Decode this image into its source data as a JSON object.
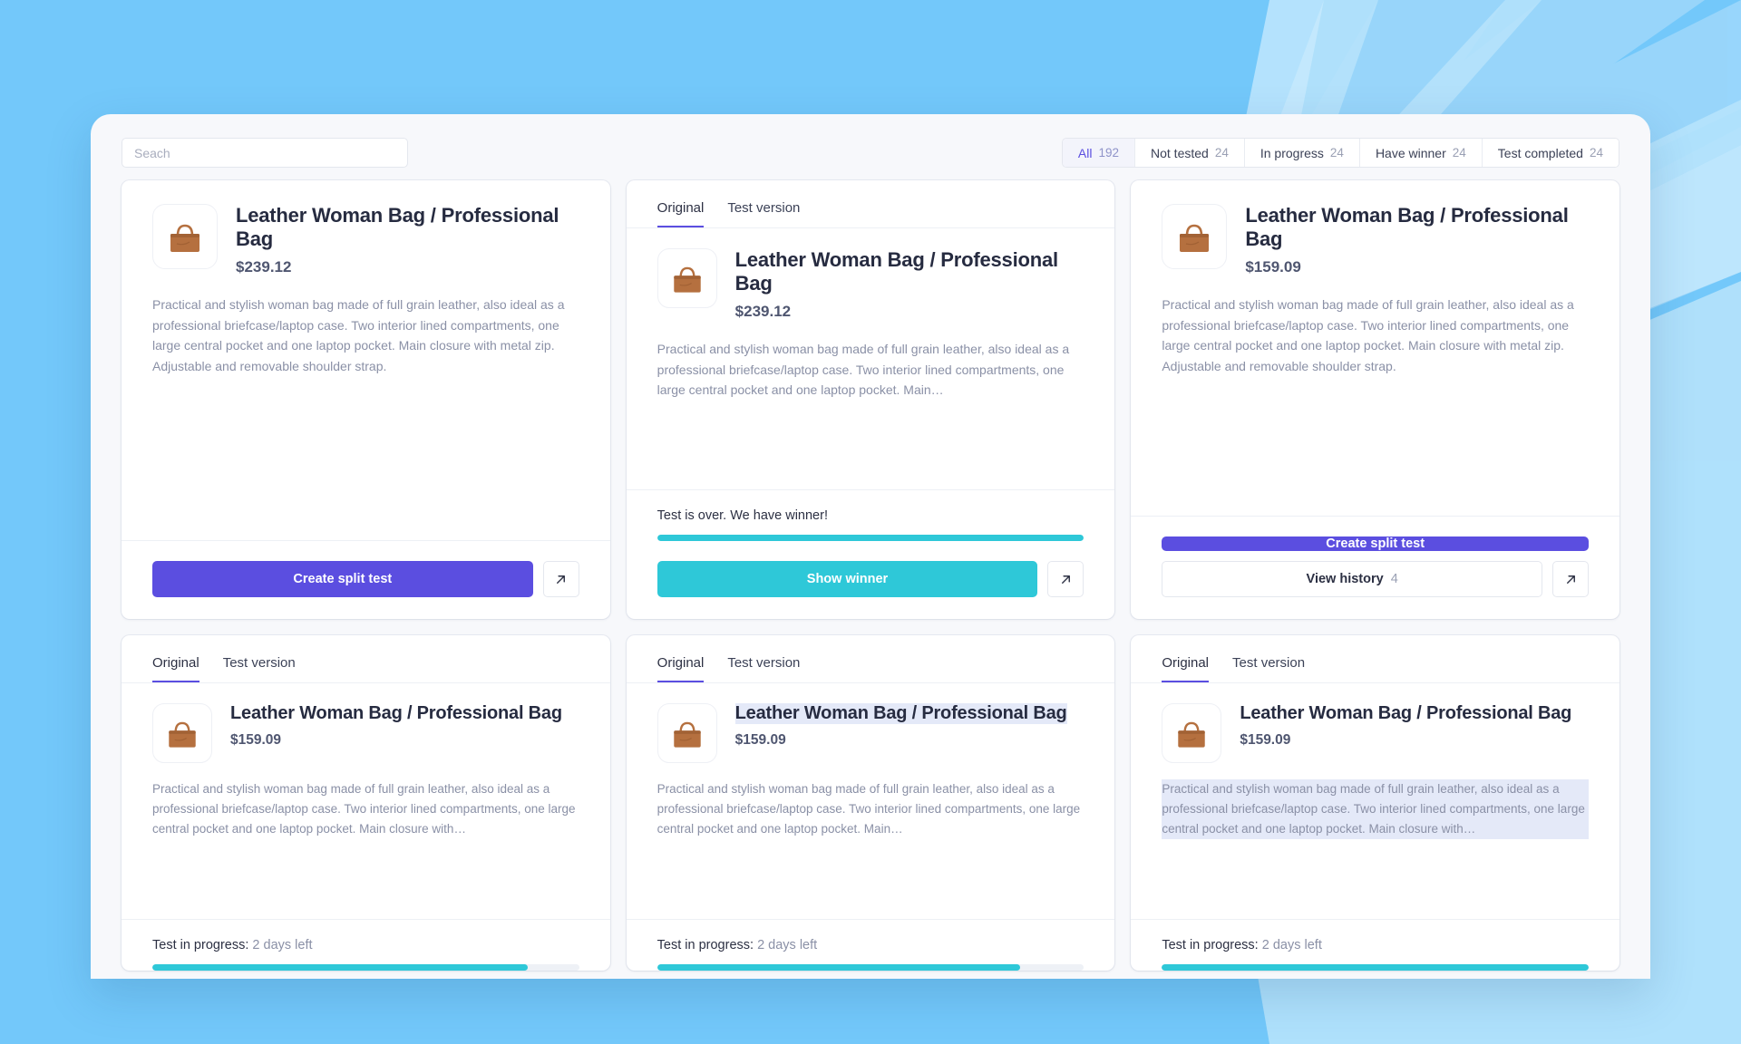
{
  "theme": {
    "page_bg": "#73c8fa",
    "accent_purple": "#5b4ee0",
    "accent_teal": "#2ec8d8",
    "window_bg": "#f7f8fb"
  },
  "search": {
    "placeholder": "Seach",
    "value": ""
  },
  "filters": [
    {
      "label": "All",
      "count": "192",
      "active": true
    },
    {
      "label": "Not tested",
      "count": "24",
      "active": false
    },
    {
      "label": "In progress",
      "count": "24",
      "active": false
    },
    {
      "label": "Have winner",
      "count": "24",
      "active": false
    },
    {
      "label": "Test completed",
      "count": "24",
      "active": false
    }
  ],
  "product": {
    "title": "Leather Woman Bag / Professional Bag",
    "description_full": "Practical and stylish woman bag made of full grain leather, also ideal as a professional briefcase/laptop case. Two interior lined compartments, one large central pocket and one laptop pocket. Main closure with metal zip. Adjustable and removable shoulder strap.",
    "description_truncated": "Practical and stylish woman bag made of full grain leather, also ideal as a professional briefcase/laptop case. Two interior lined compartments, one large central pocket and one laptop pocket. Main…",
    "description_truncated_wide": "Practical and stylish woman bag made of full grain leather, also ideal as a professional briefcase/laptop case. Two interior lined compartments, one large central pocket and one laptop pocket. Main closure with…"
  },
  "tabs": {
    "original": "Original",
    "test_version": "Test version"
  },
  "actions": {
    "create_split_test": "Create split test",
    "show_winner": "Show winner",
    "view_history": "View history",
    "view_history_count": "4",
    "open_icon": "external-link-arrow-icon"
  },
  "status": {
    "winner": "Test is over. We have winner!",
    "in_progress_label": "Test in progress:",
    "in_progress_value": "2 days left"
  },
  "cards": [
    {
      "id": "card-1",
      "has_tabs": false,
      "price": "$239.12",
      "description_variant": "full",
      "status_type": "none",
      "progress": 0,
      "footer": "create-split-test-with-open",
      "highlight": "none"
    },
    {
      "id": "card-2",
      "has_tabs": true,
      "price": "$239.12",
      "description_variant": "truncated",
      "status_type": "winner",
      "progress": 100,
      "footer": "show-winner-with-open",
      "highlight": "none"
    },
    {
      "id": "card-3",
      "has_tabs": false,
      "price": "$159.09",
      "description_variant": "full",
      "status_type": "none",
      "progress": 0,
      "footer": "create-and-history",
      "highlight": "none"
    },
    {
      "id": "card-4",
      "has_tabs": true,
      "price": "$159.09",
      "description_variant": "truncated_wide",
      "status_type": "in_progress",
      "progress": 88,
      "footer": "none",
      "highlight": "none"
    },
    {
      "id": "card-5",
      "has_tabs": true,
      "price": "$159.09",
      "description_variant": "truncated",
      "status_type": "in_progress",
      "progress": 85,
      "footer": "none",
      "highlight": "title"
    },
    {
      "id": "card-6",
      "has_tabs": true,
      "price": "$159.09",
      "description_variant": "truncated_wide",
      "status_type": "in_progress",
      "progress": 100,
      "footer": "none",
      "highlight": "description"
    }
  ]
}
